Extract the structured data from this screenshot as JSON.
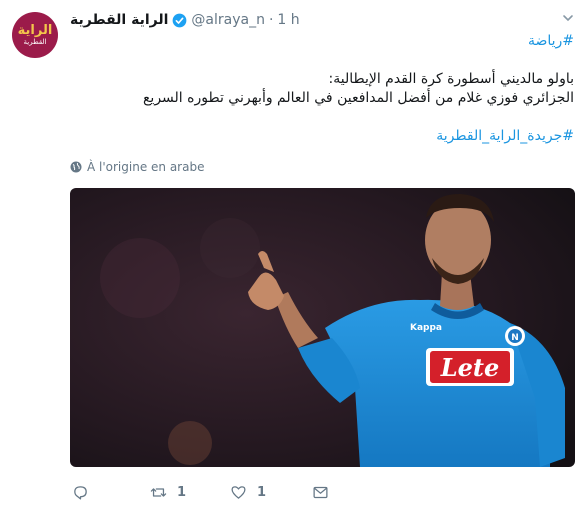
{
  "author": {
    "display_name": "الراية القطرية",
    "handle": "@alraya_n",
    "separator": "·",
    "time": "1 h",
    "verified": true,
    "avatar_logo_text": "الراية",
    "avatar_logo_sub": "القطرية"
  },
  "tweet": {
    "hashtag_sport": "#رياضة",
    "line1": "باولو مالديني أسطورة كرة القدم الإيطالية:",
    "line2": "الجزائري فوزي غلام من أفضل المدافعين في العالم وأبهرني تطوره السريع",
    "hashtag_paper": "#جريدة_الراية_القطرية"
  },
  "translation": {
    "label": "À l'origine en arabe",
    "icon": "globe-icon"
  },
  "media": {
    "jersey_sponsor": "Lete",
    "jersey_brand": "Kappa",
    "colors": {
      "jersey": "#1e8fd8",
      "background": "#2a1a24",
      "sponsor_box": "#d4202a"
    }
  },
  "actions": {
    "reply_count": "",
    "retweet_count": "1",
    "like_count": "1"
  },
  "colors": {
    "link": "#1b95e0",
    "muted": "#657786",
    "verified": "#1da1f2"
  }
}
